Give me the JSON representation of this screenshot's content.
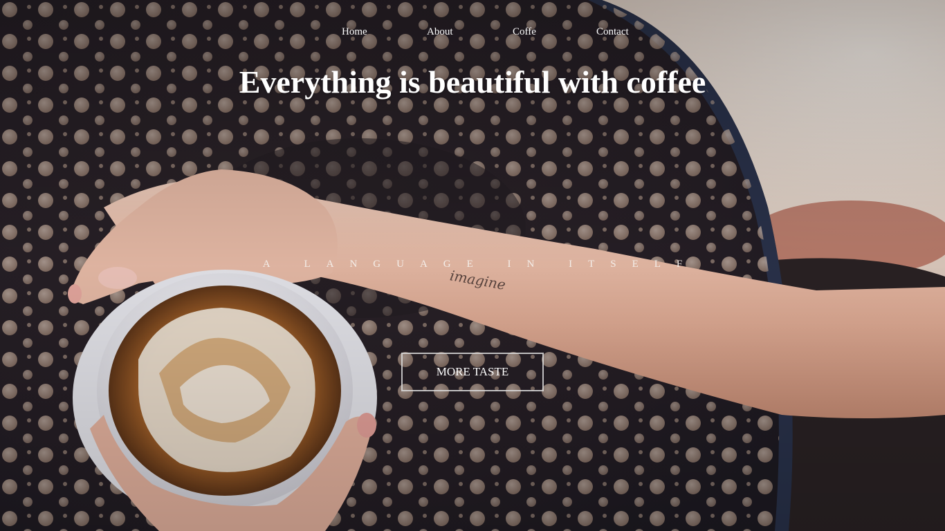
{
  "nav": {
    "items": [
      {
        "label": "Home"
      },
      {
        "label": "About"
      },
      {
        "label": "Coffe"
      },
      {
        "label": "Contact"
      }
    ]
  },
  "hero": {
    "headline": "Everything is beautiful with coffee",
    "tagline": "A LANGUAGE IN ITSELF",
    "cta_label": "MORE TASTE",
    "background_image": "coffee cup with latte art held on perforated metal table",
    "tattoo_text": "imagine"
  },
  "colors": {
    "text": "#ffffff",
    "background_dark": "#2a2224",
    "button_border": "#dcdcdc"
  }
}
